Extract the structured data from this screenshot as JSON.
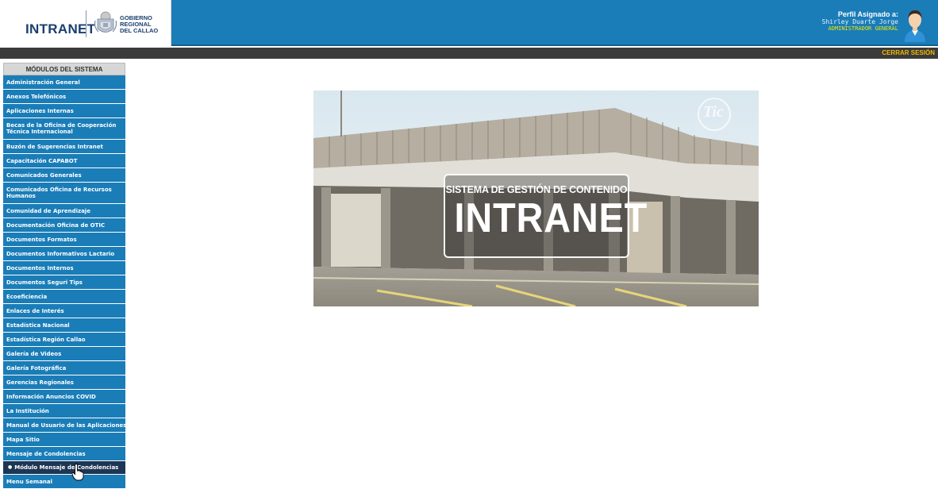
{
  "header": {
    "logo_text": "INTRANET",
    "org_line1": "GOBIERNO",
    "org_line2": "REGIONAL",
    "org_line3": "DEL CALLAO"
  },
  "profile": {
    "label": "Perfil Asignado a:",
    "name": "Shirley Duarte Jorge",
    "role": "ADMINISTRADOR GENERAL"
  },
  "topbar": {
    "logout_label": "CERRAR SESIÓN"
  },
  "sidebar": {
    "title": "MÓDULOS DEL SISTEMA",
    "items": [
      {
        "label": "Administración General"
      },
      {
        "label": "Anexos Telefónicos"
      },
      {
        "label": "Aplicaciones Internas"
      },
      {
        "label": "Becas de la Oficina de Cooperación Técnica Internacional"
      },
      {
        "label": "Buzón de Sugerencias Intranet"
      },
      {
        "label": "Capacitación CAPABOT"
      },
      {
        "label": "Comunicados Generales"
      },
      {
        "label": "Comunicados Oficina de Recursos Humanos"
      },
      {
        "label": "Comunidad de Aprendizaje"
      },
      {
        "label": "Documentación Oficina de OTIC"
      },
      {
        "label": "Documentos Formatos"
      },
      {
        "label": "Documentos Informativos Lactario"
      },
      {
        "label": "Documentos Internos"
      },
      {
        "label": "Documentos Seguri Tips"
      },
      {
        "label": "Ecoeficiencia"
      },
      {
        "label": "Enlaces de Interés"
      },
      {
        "label": "Estadística Nacional"
      },
      {
        "label": "Estadística Región Callao"
      },
      {
        "label": "Galería de Videos"
      },
      {
        "label": "Galería Fotográfica"
      },
      {
        "label": "Gerencias Regionales"
      },
      {
        "label": "Información Anuncios COVID"
      },
      {
        "label": "La Institución"
      },
      {
        "label": "Manual de Usuario de las Aplicaciones"
      },
      {
        "label": "Mapa Sitio"
      },
      {
        "label": "Mensaje de Condolencias"
      },
      {
        "label": "Módulo Mensaje de Condolencias"
      },
      {
        "label": "Menu Semanal"
      }
    ]
  },
  "banner": {
    "line1": "SISTEMA DE GESTIÓN DE CONTENIDO",
    "line2": "INTRANET",
    "watermark": "Tic"
  },
  "colors": {
    "header_blue": "#1a7db8",
    "menu_blue": "#1a7db8",
    "submenu_dark": "#1d3654",
    "dark_bar": "#3b3b3b",
    "logout_orange": "#f2b705",
    "role_yellow": "#f2e600"
  },
  "icons": {
    "avatar": "user-avatar-icon",
    "seal": "coat-of-arms-icon",
    "cursor": "hand-pointer-icon"
  }
}
